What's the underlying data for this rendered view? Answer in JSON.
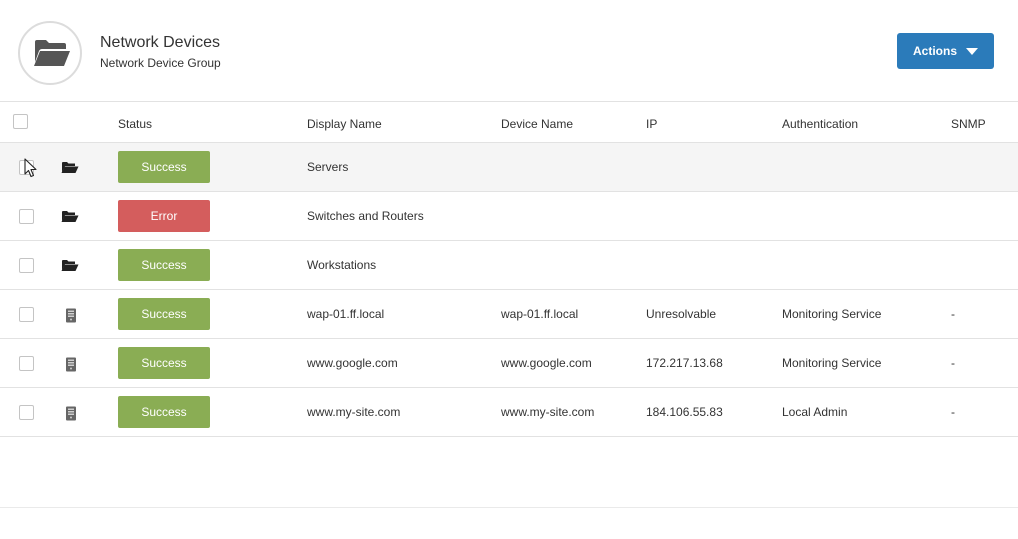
{
  "header": {
    "title": "Network Devices",
    "subtitle": "Network Device Group",
    "actions_label": "Actions"
  },
  "columns": {
    "status": "Status",
    "display_name": "Display Name",
    "device_name": "Device Name",
    "ip": "IP",
    "authentication": "Authentication",
    "snmp": "SNMP"
  },
  "colors": {
    "success": "#8aad54",
    "error": "#d45d5d",
    "primary": "#2b7bba"
  },
  "rows": [
    {
      "type": "folder-icon",
      "status": "Success",
      "display_name": "Servers",
      "device_name": "",
      "ip": "",
      "authentication": "",
      "snmp": ""
    },
    {
      "type": "folder-icon",
      "status": "Error",
      "display_name": "Switches and Routers",
      "device_name": "",
      "ip": "",
      "authentication": "",
      "snmp": ""
    },
    {
      "type": "folder-icon",
      "status": "Success",
      "display_name": "Workstations",
      "device_name": "",
      "ip": "",
      "authentication": "",
      "snmp": ""
    },
    {
      "type": "device-icon",
      "status": "Success",
      "display_name": "wap-01.ff.local",
      "device_name": "wap-01.ff.local",
      "ip": "Unresolvable",
      "authentication": "Monitoring Service",
      "snmp": "-"
    },
    {
      "type": "device-icon",
      "status": "Success",
      "display_name": "www.google.com",
      "device_name": "www.google.com",
      "ip": "172.217.13.68",
      "authentication": "Monitoring Service",
      "snmp": "-"
    },
    {
      "type": "device-icon",
      "status": "Success",
      "display_name": "www.my-site.com",
      "device_name": "www.my-site.com",
      "ip": "184.106.55.83",
      "authentication": "Local Admin",
      "snmp": "-"
    }
  ]
}
